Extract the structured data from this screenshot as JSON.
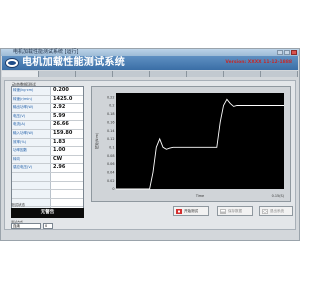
{
  "window": {
    "title": "电机加载性能测试系统 [运行]"
  },
  "header": {
    "app_title": "电机加载性能测试系统",
    "version": "Version: XXXX 11-12-1888",
    "logo_icon": "brand-logo-icon"
  },
  "tabs": [
    "",
    "",
    "",
    "",
    "",
    "",
    "",
    ""
  ],
  "panel": {
    "title": "动态数据测试",
    "rows": [
      {
        "label": "转速(kg·cm)",
        "value": "0.200"
      },
      {
        "label": "转速(r/min)",
        "value": "1425.0"
      },
      {
        "label": "输出功率(W)",
        "value": "2.92"
      },
      {
        "label": "电压(V)",
        "value": "5.99"
      },
      {
        "label": "电流(A)",
        "value": "26.66"
      },
      {
        "label": "输入功率(W)",
        "value": "159.80"
      },
      {
        "label": "效率(%)",
        "value": "1.83"
      },
      {
        "label": "功率因数",
        "value": "1.00"
      },
      {
        "label": "转向",
        "value": "CW"
      },
      {
        "label": "感应电压(V)",
        "value": "2.96"
      },
      {
        "label": "",
        "value": ""
      },
      {
        "label": "",
        "value": ""
      },
      {
        "label": "",
        "value": ""
      },
      {
        "label": "",
        "value": ""
      },
      {
        "label": "",
        "value": ""
      }
    ],
    "status_caption": "测试状态",
    "status_text": "无警告",
    "mode_label": "测试方式",
    "mode_value": "连续",
    "mode_extra": "0"
  },
  "chart_data": {
    "type": "line",
    "title": "",
    "xlabel": "Time",
    "ylabel": "扭矩(N·m)",
    "ylim": [
      0,
      0.23
    ],
    "yticks": [
      "0.22",
      "0.2",
      "0.18",
      "0.16",
      "0.14",
      "0.12",
      "0.1",
      "0.08",
      "0.06",
      "0.04",
      "0.02",
      "0"
    ],
    "x_end_label": "0.15(S)",
    "background": "#000000",
    "line_color": "#ffffff",
    "x": [
      0,
      0.1,
      0.2,
      0.22,
      0.24,
      0.26,
      0.28,
      0.3,
      0.32,
      0.34,
      0.6,
      0.62,
      0.64,
      0.66,
      0.68,
      0.7,
      0.72,
      0.75,
      1.0
    ],
    "y": [
      0,
      0,
      0,
      0.04,
      0.1,
      0.12,
      0.1,
      0.095,
      0.098,
      0.1,
      0.1,
      0.16,
      0.2,
      0.215,
      0.205,
      0.198,
      0.2,
      0.2,
      0.2
    ]
  },
  "buttons": [
    {
      "label": "开始测试",
      "icon": "start-icon",
      "disabled": false
    },
    {
      "label": "保存数据",
      "icon": "save-icon",
      "disabled": true
    },
    {
      "label": "退出系统",
      "icon": "exit-icon",
      "disabled": true
    }
  ],
  "colors": {
    "header": "#3a6ea6",
    "accent_red": "#c62828",
    "label_blue": "#1f5ea8"
  }
}
